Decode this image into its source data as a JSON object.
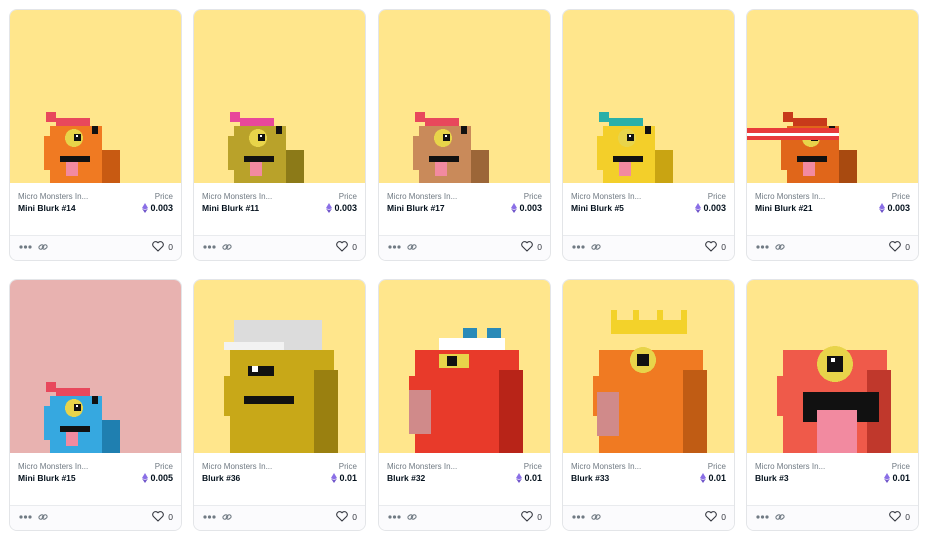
{
  "colors": {
    "accent": "#8a6fe6",
    "background_yellow": "#ffe68c",
    "background_pink": "#e8b2b0"
  },
  "labels": {
    "price": "Price"
  },
  "icons": {
    "more": "more-horizontal-icon",
    "link": "link-icon",
    "like": "heart-icon",
    "currency": "ethereum-icon"
  },
  "cards": [
    {
      "collection": "Micro Monsters In...",
      "name": "Mini Blurk #14",
      "price": "0.003",
      "likes": "0",
      "bg": "#ffe68c"
    },
    {
      "collection": "Micro Monsters In...",
      "name": "Mini Blurk #11",
      "price": "0.003",
      "likes": "0",
      "bg": "#ffe68c"
    },
    {
      "collection": "Micro Monsters In...",
      "name": "Mini Blurk #17",
      "price": "0.003",
      "likes": "0",
      "bg": "#ffe68c"
    },
    {
      "collection": "Micro Monsters In...",
      "name": "Mini Blurk #5",
      "price": "0.003",
      "likes": "0",
      "bg": "#ffe68c"
    },
    {
      "collection": "Micro Monsters In...",
      "name": "Mini Blurk #21",
      "price": "0.003",
      "likes": "0",
      "bg": "#ffe68c"
    },
    {
      "collection": "Micro Monsters In...",
      "name": "Mini Blurk #15",
      "price": "0.005",
      "likes": "0",
      "bg": "#e8b2b0"
    },
    {
      "collection": "Micro Monsters In...",
      "name": "Blurk #36",
      "price": "0.01",
      "likes": "0",
      "bg": "#ffe68c"
    },
    {
      "collection": "Micro Monsters In...",
      "name": "Blurk #32",
      "price": "0.01",
      "likes": "0",
      "bg": "#ffe68c"
    },
    {
      "collection": "Micro Monsters In...",
      "name": "Blurk #33",
      "price": "0.01",
      "likes": "0",
      "bg": "#ffe68c"
    },
    {
      "collection": "Micro Monsters In...",
      "name": "Blurk #3",
      "price": "0.01",
      "likes": "0",
      "bg": "#ffe68c"
    }
  ]
}
